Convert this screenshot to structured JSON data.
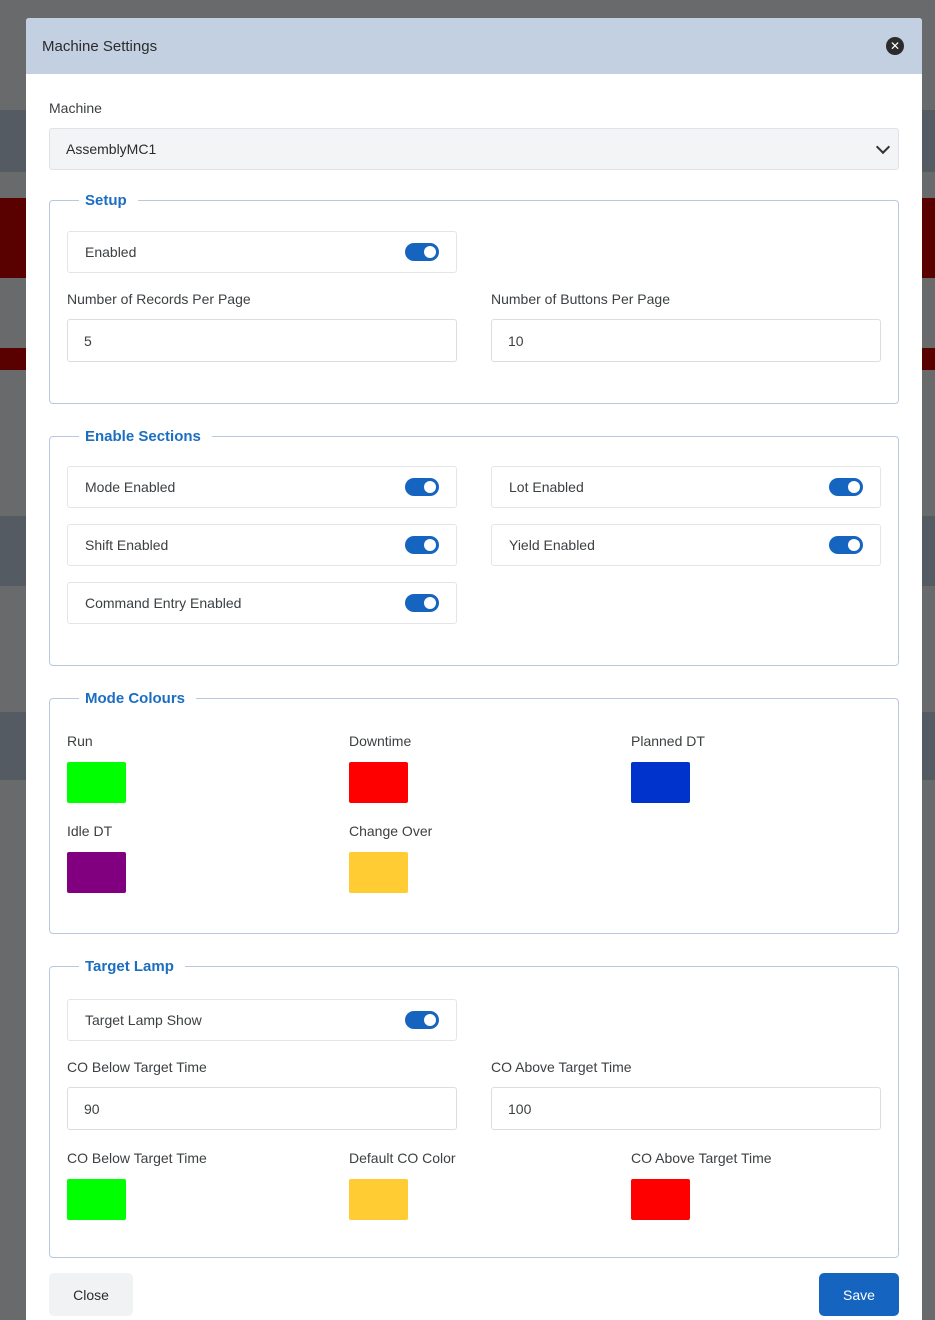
{
  "modal": {
    "title": "Machine Settings"
  },
  "machine": {
    "label": "Machine",
    "selected": "AssemblyMC1"
  },
  "setup": {
    "legend": "Setup",
    "enabled_label": "Enabled",
    "enabled_on": true,
    "records_label": "Number of Records Per Page",
    "records_value": "5",
    "buttons_label": "Number of Buttons Per Page",
    "buttons_value": "10"
  },
  "sections": {
    "legend": "Enable Sections",
    "items": [
      {
        "label": "Mode Enabled",
        "on": true
      },
      {
        "label": "Lot Enabled",
        "on": true
      },
      {
        "label": "Shift Enabled",
        "on": true
      },
      {
        "label": "Yield Enabled",
        "on": true
      },
      {
        "label": "Command Entry Enabled",
        "on": true
      }
    ]
  },
  "mode_colours": {
    "legend": "Mode Colours",
    "items": [
      {
        "label": "Run",
        "color": "#00ff00"
      },
      {
        "label": "Downtime",
        "color": "#ff0000"
      },
      {
        "label": "Planned DT",
        "color": "#0033cc"
      },
      {
        "label": "Idle DT",
        "color": "#800080"
      },
      {
        "label": "Change Over",
        "color": "#ffcc33"
      }
    ]
  },
  "target_lamp": {
    "legend": "Target Lamp",
    "show_label": "Target Lamp Show",
    "show_on": true,
    "below_label": "CO Below Target Time",
    "below_value": "90",
    "above_label": "CO Above Target Time",
    "above_value": "100",
    "colours": [
      {
        "label": "CO Below Target Time",
        "color": "#00ff00"
      },
      {
        "label": "Default CO Color",
        "color": "#ffcc33"
      },
      {
        "label": "CO Above Target Time",
        "color": "#ff0000"
      }
    ]
  },
  "footer": {
    "close_label": "Close",
    "save_label": "Save"
  },
  "theme": {
    "accent": "#1565c0",
    "header_bg": "#c2d0e1",
    "legend_color": "#1b6ec2"
  }
}
